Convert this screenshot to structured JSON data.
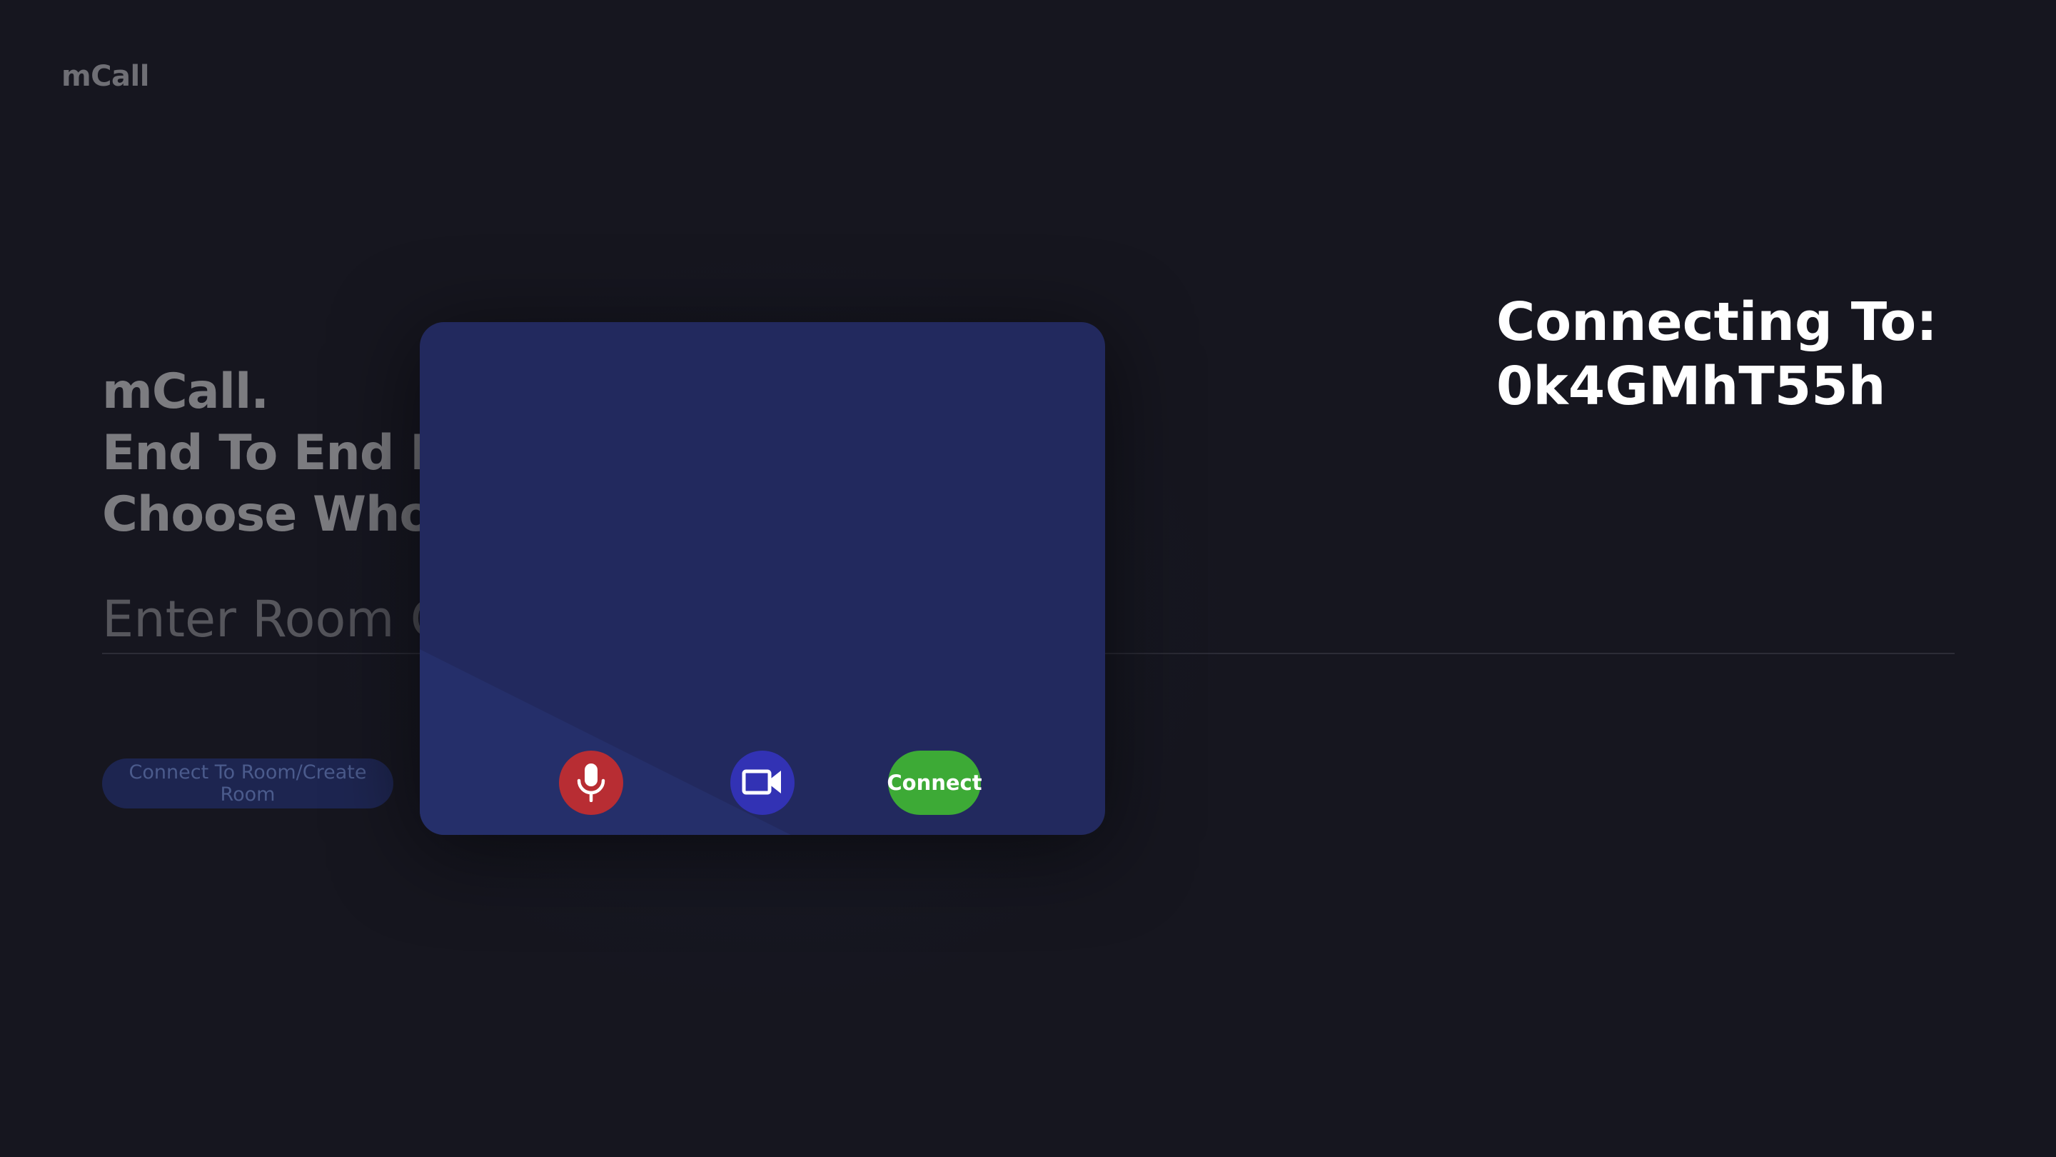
{
  "app": {
    "brand": "mCall"
  },
  "hero": {
    "line1": "mCall.",
    "line2": "End To End En",
    "line3": "Choose Who Y"
  },
  "room_input": {
    "placeholder": "Enter Room Co",
    "value": ""
  },
  "connect_room_button": {
    "label": "Connect To Room/Create Room"
  },
  "modal": {
    "mic_icon": "microphone-icon",
    "camera_icon": "video-camera-icon",
    "connect_label": "Connect"
  },
  "connecting": {
    "label": "Connecting To:",
    "room_code": "0k4GMhT55h"
  },
  "colors": {
    "background": "#16161f",
    "modal": "#22295e",
    "mic": "#b82d33",
    "camera": "#3232b4",
    "connect": "#3daa36"
  }
}
